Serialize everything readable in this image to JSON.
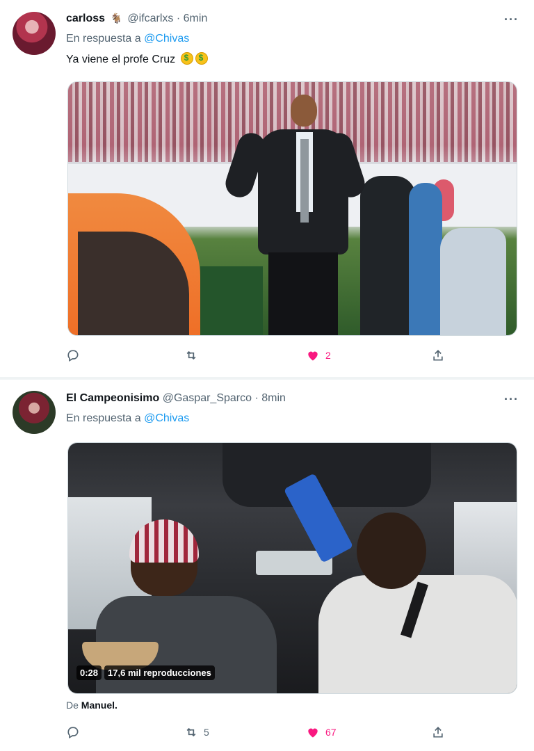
{
  "tweets": [
    {
      "display_name": "carloss",
      "handle": "@ifcarlxs",
      "separator": "·",
      "time": "6min",
      "reply_prefix": "En respuesta a",
      "reply_to": "@Chivas",
      "text": "Ya viene el profe Cruz",
      "emojis": [
        "money-mouth-face",
        "money-mouth-face"
      ],
      "media": {
        "type": "photo",
        "description_icon": "image-icon"
      },
      "actions": {
        "reply": "",
        "retweet": "",
        "like": "2",
        "share": ""
      }
    },
    {
      "display_name": "El Campeonisimo",
      "handle": "@Gaspar_Sparco",
      "separator": "·",
      "time": "8min",
      "reply_prefix": "En respuesta a",
      "reply_to": "@Chivas",
      "media": {
        "type": "video",
        "duration": "0:28",
        "views": "17,6 mil reproducciones"
      },
      "attribution_prefix": "De",
      "attribution_name": "Manuel.",
      "actions": {
        "reply": "",
        "retweet": "5",
        "like": "67",
        "share": ""
      }
    }
  ],
  "colors": {
    "accent": "#1d9bf0",
    "like": "#f91880",
    "muted": "#536471",
    "text": "#0f1419",
    "separator": "#eff3f4"
  }
}
